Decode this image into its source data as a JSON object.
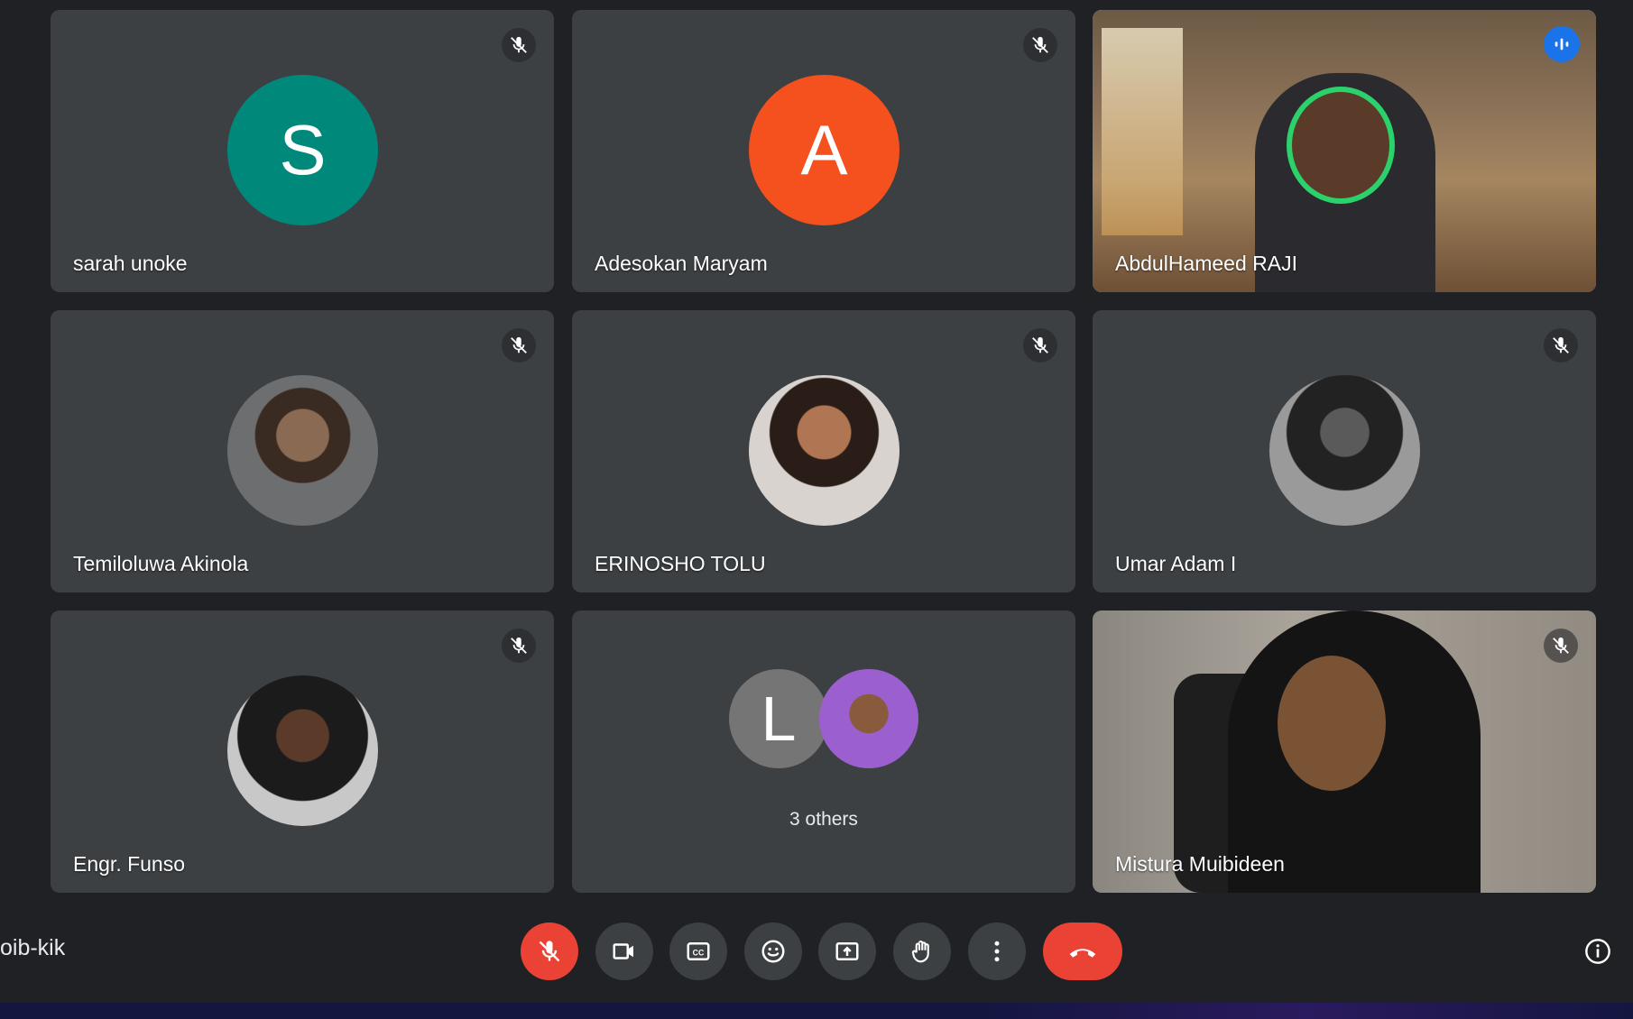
{
  "participants": [
    {
      "name": "sarah unoke",
      "initial": "S",
      "avatar_color": "#00897b",
      "muted": true
    },
    {
      "name": "Adesokan Maryam",
      "initial": "A",
      "avatar_color": "#f4511e",
      "muted": true
    },
    {
      "name": "AbdulHameed RAJI",
      "speaking": true
    },
    {
      "name": "Temiloluwa Akinola",
      "muted": true
    },
    {
      "name": "ERINOSHO TOLU",
      "muted": true
    },
    {
      "name": "Umar Adam I",
      "muted": true
    },
    {
      "name": "Engr. Funso",
      "muted": true
    },
    {
      "name": "Mistura Muibideen",
      "muted": true
    }
  ],
  "others": {
    "initial": "L",
    "label": "3 others",
    "avatar_color": "#757575"
  },
  "meeting_code": "oib-kik",
  "controls": [
    {
      "name": "microphone-off",
      "icon": "mic-off-icon",
      "color": "#ea4335"
    },
    {
      "name": "camera",
      "icon": "camera-icon"
    },
    {
      "name": "captions",
      "icon": "cc-icon"
    },
    {
      "name": "emoji",
      "icon": "emoji-icon"
    },
    {
      "name": "present",
      "icon": "present-screen-icon"
    },
    {
      "name": "raise-hand",
      "icon": "hand-icon"
    },
    {
      "name": "more-options",
      "icon": "more-vert-icon"
    },
    {
      "name": "leave-call",
      "icon": "phone-hangup-icon",
      "color": "#ea4335"
    }
  ],
  "accent_color": "#8ab4f8"
}
